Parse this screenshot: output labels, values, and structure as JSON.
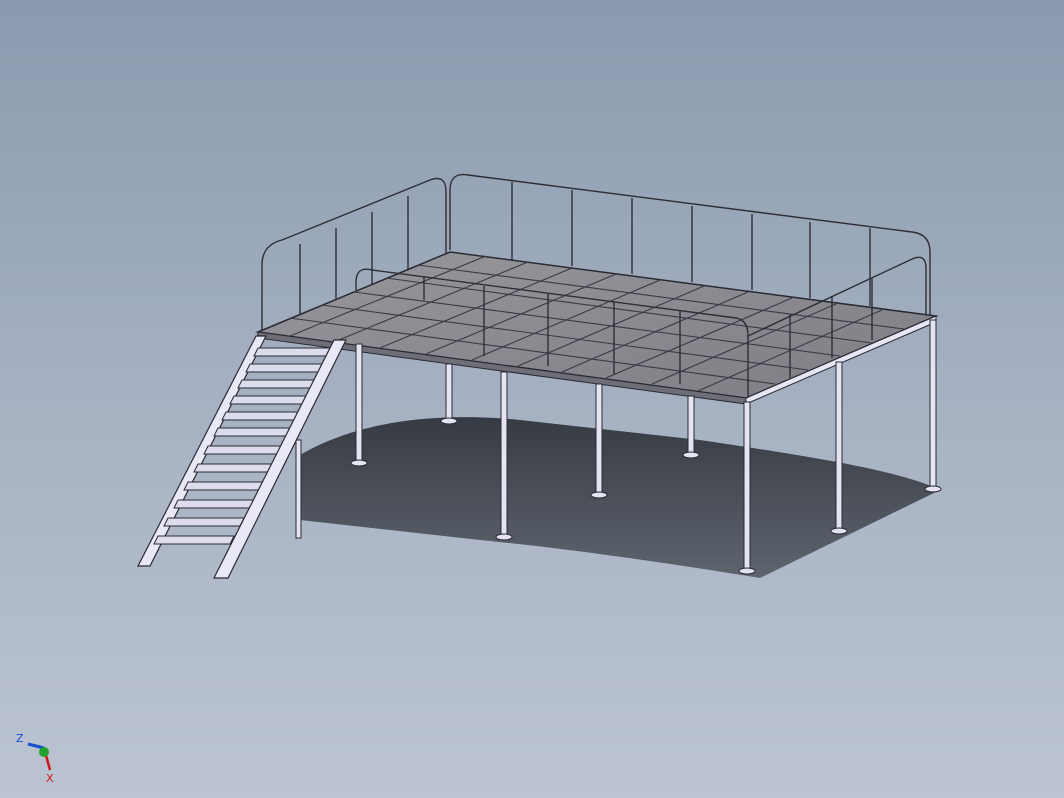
{
  "viewport": {
    "background_top": "#8a9aae",
    "background_bottom": "#bcc4d2"
  },
  "model": {
    "name": "mezzanine-platform-with-stairs",
    "deck_fill": "#8a8a90",
    "frame_color": "#3a3a44",
    "steel_light": "#dcdcf0",
    "shadow_color": "#3c4048"
  },
  "triad": {
    "z_label": "Z",
    "x_label": "X",
    "z_color": "#1a4fd0",
    "x_color": "#d01818",
    "y_color": "#22a030"
  }
}
